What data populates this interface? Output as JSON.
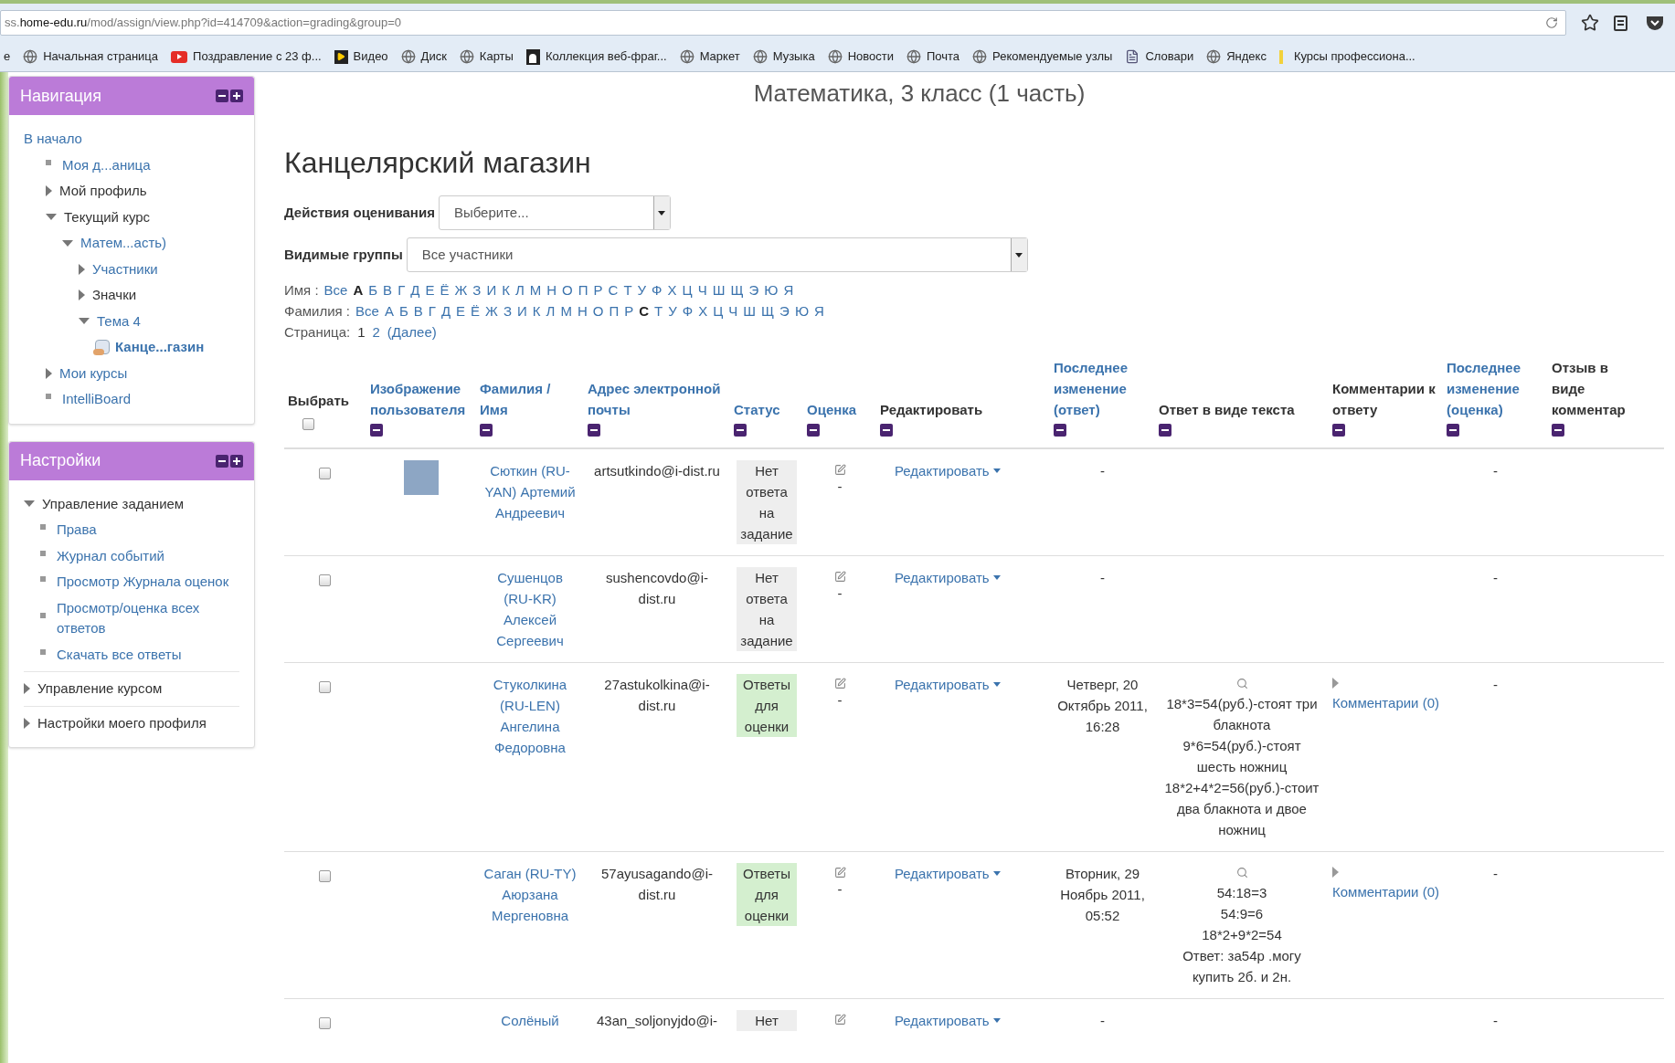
{
  "browser": {
    "url": [
      {
        "text": "ss.",
        "strong": false
      },
      {
        "text": "home-edu.ru",
        "strong": true
      },
      {
        "text": "/mod/assign/view.php?id=414709&action=grading&group=0",
        "strong": false
      }
    ],
    "bookmarks": [
      {
        "label": "е",
        "kind": "none"
      },
      {
        "label": "Начальная страница",
        "kind": "globe"
      },
      {
        "label": "Поздравление с 23 ф...",
        "kind": "video"
      },
      {
        "label": "Видео",
        "kind": "play"
      },
      {
        "label": "Диск",
        "kind": "globe"
      },
      {
        "label": "Карты",
        "kind": "globe"
      },
      {
        "label": "Коллекция веб-фраг...",
        "kind": "clip"
      },
      {
        "label": "Маркет",
        "kind": "globe"
      },
      {
        "label": "Музыка",
        "kind": "globe"
      },
      {
        "label": "Новости",
        "kind": "globe"
      },
      {
        "label": "Почта",
        "kind": "globe"
      },
      {
        "label": "Рекомендуемые узлы",
        "kind": "globe"
      },
      {
        "label": "Словари",
        "kind": "page"
      },
      {
        "label": "Яндекс",
        "kind": "globe"
      },
      {
        "label": "Курсы профессиона...",
        "kind": "mark"
      }
    ]
  },
  "navigation": {
    "title": "Навигация",
    "items": [
      {
        "label": "В начало",
        "kind": "root",
        "link": true,
        "children": [
          {
            "label": "Моя д...аница",
            "kind": "leaf",
            "link": true
          },
          {
            "label": "Мой профиль",
            "kind": "branch",
            "link": false,
            "expanded": false
          },
          {
            "label": "Текущий курс",
            "kind": "branch",
            "link": false,
            "expanded": true,
            "children": [
              {
                "label": "Матем...асть)",
                "kind": "branch",
                "link": true,
                "expanded": true,
                "children": [
                  {
                    "label": "Участники",
                    "kind": "branch",
                    "link": true,
                    "expanded": false
                  },
                  {
                    "label": "Значки",
                    "kind": "branch",
                    "link": false,
                    "expanded": false
                  },
                  {
                    "label": "Тема 4",
                    "kind": "branch",
                    "link": true,
                    "expanded": true,
                    "children": [
                      {
                        "label": "Канце...газин",
                        "kind": "activity",
                        "link": true
                      }
                    ]
                  }
                ]
              }
            ]
          },
          {
            "label": "Мои курсы",
            "kind": "branch",
            "link": true,
            "expanded": false
          },
          {
            "label": "IntelliBoard",
            "kind": "leaf",
            "link": true
          }
        ]
      }
    ]
  },
  "settings": {
    "title": "Настройки",
    "items": [
      {
        "label": "Управление заданием",
        "kind": "branch",
        "link": false,
        "expanded": true,
        "children": [
          {
            "label": "Права",
            "kind": "leaf",
            "link": true
          },
          {
            "label": "Журнал событий",
            "kind": "leaf",
            "link": true
          },
          {
            "label": "Просмотр Журнала оценок",
            "kind": "leaf",
            "link": true
          },
          {
            "label": "Просмотр/оценка всех ответов",
            "kind": "leaf",
            "link": true
          },
          {
            "label": "Скачать все ответы",
            "kind": "leaf",
            "link": true
          }
        ]
      },
      {
        "label": "Управление курсом",
        "kind": "branch",
        "link": false,
        "expanded": false
      },
      {
        "label": "Настройки моего профиля",
        "kind": "branch",
        "link": false,
        "expanded": false
      }
    ]
  },
  "course_title": "Математика, 3 класс (1 часть)",
  "page_title": "Канцелярский магазин",
  "grading_action": {
    "label": "Действия оценивания",
    "value": "Выберите..."
  },
  "groups": {
    "label": "Видимые группы",
    "value": "Все участники"
  },
  "first_name_filter": {
    "label": "Имя :",
    "letters": [
      {
        "label": "Все",
        "selected": false
      },
      {
        "label": "А",
        "selected": true
      },
      {
        "label": "Б",
        "selected": false
      },
      {
        "label": "В",
        "selected": false
      },
      {
        "label": "Г",
        "selected": false
      },
      {
        "label": "Д",
        "selected": false
      },
      {
        "label": "Е",
        "selected": false
      },
      {
        "label": "Ё",
        "selected": false
      },
      {
        "label": "Ж",
        "selected": false
      },
      {
        "label": "З",
        "selected": false
      },
      {
        "label": "И",
        "selected": false
      },
      {
        "label": "К",
        "selected": false
      },
      {
        "label": "Л",
        "selected": false
      },
      {
        "label": "М",
        "selected": false
      },
      {
        "label": "Н",
        "selected": false
      },
      {
        "label": "О",
        "selected": false
      },
      {
        "label": "П",
        "selected": false
      },
      {
        "label": "Р",
        "selected": false
      },
      {
        "label": "С",
        "selected": false
      },
      {
        "label": "Т",
        "selected": false
      },
      {
        "label": "У",
        "selected": false
      },
      {
        "label": "Ф",
        "selected": false
      },
      {
        "label": "Х",
        "selected": false
      },
      {
        "label": "Ц",
        "selected": false
      },
      {
        "label": "Ч",
        "selected": false
      },
      {
        "label": "Ш",
        "selected": false
      },
      {
        "label": "Щ",
        "selected": false
      },
      {
        "label": "Э",
        "selected": false
      },
      {
        "label": "Ю",
        "selected": false
      },
      {
        "label": "Я",
        "selected": false
      }
    ]
  },
  "last_name_filter": {
    "label": "Фамилия :",
    "letters": [
      {
        "label": "Все",
        "selected": false
      },
      {
        "label": "А",
        "selected": false
      },
      {
        "label": "Б",
        "selected": false
      },
      {
        "label": "В",
        "selected": false
      },
      {
        "label": "Г",
        "selected": false
      },
      {
        "label": "Д",
        "selected": false
      },
      {
        "label": "Е",
        "selected": false
      },
      {
        "label": "Ё",
        "selected": false
      },
      {
        "label": "Ж",
        "selected": false
      },
      {
        "label": "З",
        "selected": false
      },
      {
        "label": "И",
        "selected": false
      },
      {
        "label": "К",
        "selected": false
      },
      {
        "label": "Л",
        "selected": false
      },
      {
        "label": "М",
        "selected": false
      },
      {
        "label": "Н",
        "selected": false
      },
      {
        "label": "О",
        "selected": false
      },
      {
        "label": "П",
        "selected": false
      },
      {
        "label": "Р",
        "selected": false
      },
      {
        "label": "С",
        "selected": true
      },
      {
        "label": "Т",
        "selected": false
      },
      {
        "label": "У",
        "selected": false
      },
      {
        "label": "Ф",
        "selected": false
      },
      {
        "label": "Х",
        "selected": false
      },
      {
        "label": "Ц",
        "selected": false
      },
      {
        "label": "Ч",
        "selected": false
      },
      {
        "label": "Ш",
        "selected": false
      },
      {
        "label": "Щ",
        "selected": false
      },
      {
        "label": "Э",
        "selected": false
      },
      {
        "label": "Ю",
        "selected": false
      },
      {
        "label": "Я",
        "selected": false
      }
    ]
  },
  "pagination": {
    "label": "Страница:",
    "pages": [
      {
        "label": "1",
        "selected": true
      },
      {
        "label": "2",
        "selected": false
      }
    ],
    "next": "(Далее)"
  },
  "table": {
    "select_all": {
      "checked": false
    },
    "columns": [
      {
        "label": "Выбрать",
        "sortable": false,
        "kind": "select"
      },
      {
        "label": "Изображение пользователя",
        "sortable": true,
        "kind": "collapse"
      },
      {
        "label": "Фамилия / Имя",
        "sortable": true,
        "kind": "collapse"
      },
      {
        "label": "Адрес электронной почты",
        "sortable": true,
        "kind": "collapse"
      },
      {
        "label": "Статус",
        "sortable": true,
        "kind": "collapse"
      },
      {
        "label": "Оценка",
        "sortable": true,
        "kind": "collapse"
      },
      {
        "label": "Редактировать",
        "sortable": false,
        "kind": "collapse"
      },
      {
        "label": "Последнее изменение (ответ)",
        "sortable": true,
        "kind": "collapse"
      },
      {
        "label": "Ответ в виде текста",
        "sortable": false,
        "kind": "collapse"
      },
      {
        "label": "Комментарии к ответу",
        "sortable": false,
        "kind": "collapse"
      },
      {
        "label": "Последнее изменение (оценка)",
        "sortable": true,
        "kind": "collapse"
      },
      {
        "label": "Отзыв в виде комментар",
        "sortable": false,
        "kind": "collapse"
      }
    ],
    "rows": [
      {
        "selected": false,
        "photo": true,
        "name": "Сюткин (RU-YAN) Артемий Андреевич",
        "email": "artsutkindo@i-dist.ru",
        "status": {
          "text": "Нет ответа на задание",
          "kind": "none"
        },
        "grade": "-",
        "edit": "Редактировать",
        "modified": "-",
        "final_modified": "-"
      },
      {
        "selected": false,
        "photo": false,
        "name": "Сушенцов (RU-KR) Алексей Сергеевич",
        "email": "sushencovdo@i-dist.ru",
        "status": {
          "text": "Нет ответа на задание",
          "kind": "none"
        },
        "grade": "-",
        "edit": "Редактировать",
        "modified": "-",
        "final_modified": "-"
      },
      {
        "selected": false,
        "photo": false,
        "name": "Стуколкина (RU-LEN) Ангелина Федоровна",
        "email": "27astukolkina@i-dist.ru",
        "status": {
          "text": "Ответы для оценки",
          "kind": "submitted"
        },
        "grade": "-",
        "edit": "Редактировать",
        "modified": "Четверг, 20 Октябрь 2011, 16:28",
        "answer": [
          "18*3=54(руб.)-стоят три блакнота",
          "9*6=54(руб.)-стоят шесть ножниц",
          "18*2+4*2=56(руб.)-стоит два блакнота и двое ножниц"
        ],
        "comments": "Комментарии (0)",
        "final_modified": "-"
      },
      {
        "selected": false,
        "photo": false,
        "name": "Саган (RU-TY) Аюрзана Мергеновна",
        "email": "57ayusagando@i-dist.ru",
        "status": {
          "text": "Ответы для оценки",
          "kind": "submitted"
        },
        "grade": "-",
        "edit": "Редактировать",
        "modified": "Вторник, 29 Ноябрь 2011, 05:52",
        "answer": [
          "54:18=3",
          "54:9=6",
          "18*2+9*2=54",
          "Ответ: за54р .могу купить 2б. и 2н."
        ],
        "comments": "Комментарии (0)",
        "final_modified": "-"
      },
      {
        "selected": false,
        "photo": false,
        "name": "Солёный",
        "email": "43an_soljonyjdo@i-",
        "status": {
          "text": "Нет",
          "kind": "none"
        },
        "edit": "Редактировать",
        "modified": "-",
        "final_modified": "-"
      }
    ]
  }
}
